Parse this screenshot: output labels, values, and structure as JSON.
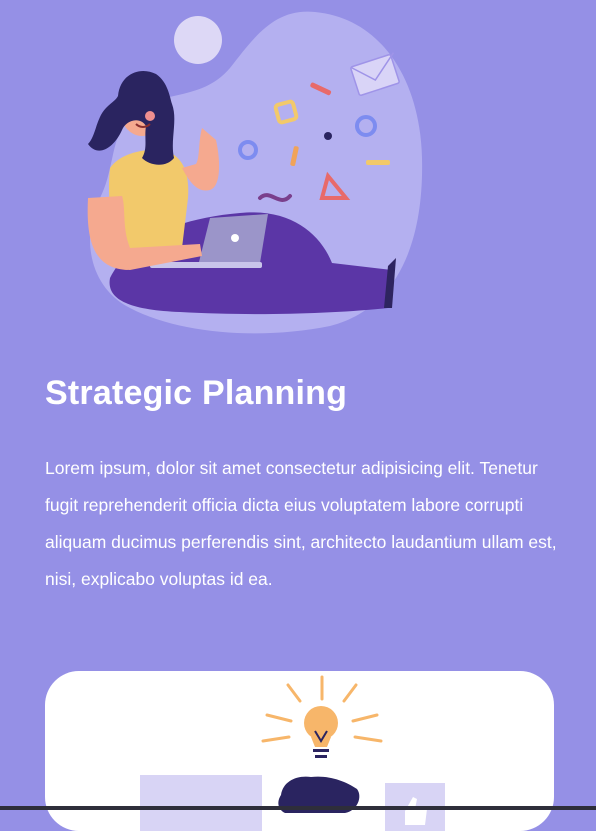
{
  "feature": {
    "title": "Strategic Planning",
    "description": "Lorem ipsum, dolor sit amet consectetur adipisicing elit. Tenetur fugit reprehenderit officia dicta eius voluptatem labore corrupti aliquam ducimus perferendis sint, architecto laudantium ullam est, nisi, explicabo voluptas id ea."
  },
  "illustrations": {
    "hero": "woman-with-laptop-illustration",
    "card": "lightbulb-idea-illustration"
  },
  "colors": {
    "background": "#9590e6",
    "blob": "#b4b0f0",
    "card": "#ffffff",
    "text": "#ffffff",
    "pants": "#5b36a6",
    "shirt": "#f2c96b",
    "bulb": "#f7b66a"
  }
}
